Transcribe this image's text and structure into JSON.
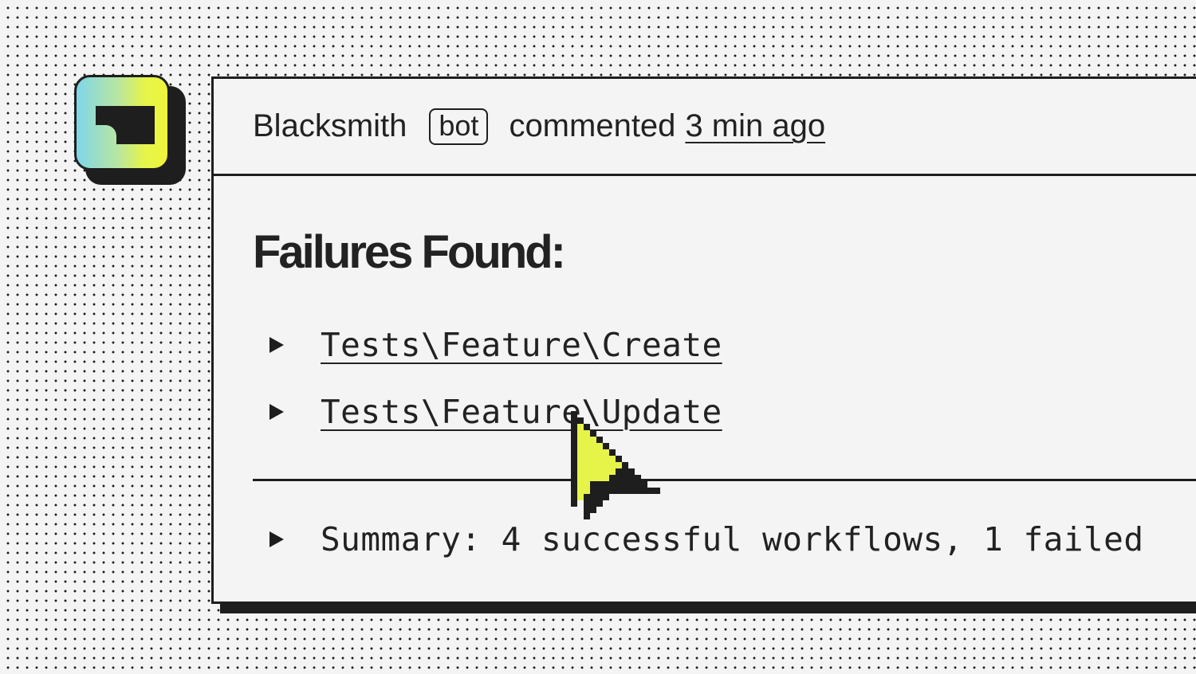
{
  "colors": {
    "ink": "#1e1e1e",
    "paper": "#f4f4f4",
    "accent_yellow": "#e6f44a",
    "accent_cyan": "#7fd6ea"
  },
  "avatar": {
    "icon": "blacksmith-logo-icon"
  },
  "comment": {
    "author": "Blacksmith",
    "badge": "bot",
    "action": "commented",
    "timestamp": "3 min ago"
  },
  "body": {
    "heading": "Failures Found:",
    "failures": [
      {
        "label": "Tests\\Feature\\Create",
        "icon": "disclosure-triangle-icon"
      },
      {
        "label": "Tests\\Feature\\Update",
        "icon": "disclosure-triangle-icon"
      }
    ],
    "summary": "Summary: 4 successful workflows, 1 failed"
  },
  "cursor": {
    "icon": "pointer-cursor-icon"
  }
}
